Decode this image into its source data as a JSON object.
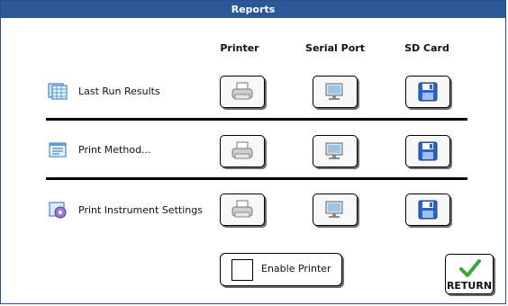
{
  "window": {
    "title": "Reports"
  },
  "columns": {
    "printer": "Printer",
    "serial": "Serial Port",
    "sd": "SD Card"
  },
  "rows": [
    {
      "label": "Last Run Results",
      "icon": "report-grid-icon"
    },
    {
      "label": "Print Method...",
      "icon": "method-document-icon"
    },
    {
      "label": "Print Instrument Settings",
      "icon": "instrument-settings-icon"
    }
  ],
  "action_icons": {
    "printer": "printer-icon",
    "serial": "serial-port-icon",
    "sd": "floppy-disk-icon"
  },
  "enable_printer": {
    "label": "Enable Printer",
    "checked": false
  },
  "return_button": {
    "label": "RETURN",
    "icon": "checkmark-icon"
  },
  "colors": {
    "titlebar": "#2b5797",
    "floppy": "#2a63c9",
    "checkmark": "#3aa63a"
  }
}
